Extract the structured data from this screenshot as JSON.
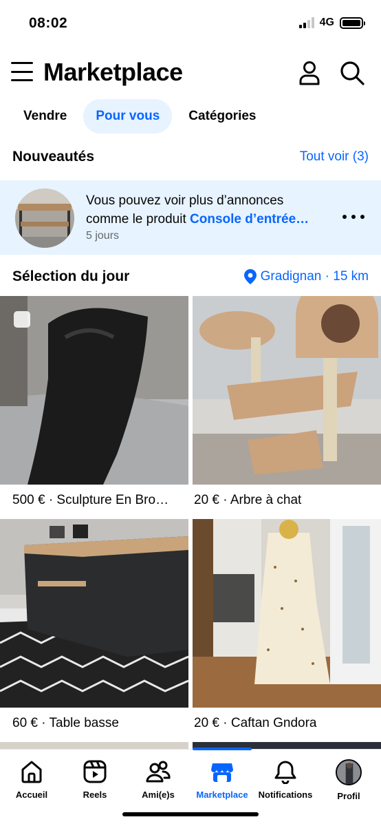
{
  "status": {
    "time": "08:02",
    "network": "4G"
  },
  "header": {
    "title": "Marketplace"
  },
  "tabs": [
    {
      "label": "Vendre",
      "active": false
    },
    {
      "label": "Pour vous",
      "active": true
    },
    {
      "label": "Catégories",
      "active": false
    }
  ],
  "news": {
    "title": "Nouveautés",
    "see_all": "Tout voir (3)",
    "card": {
      "text_line1": "Vous pouvez voir plus d’annonces",
      "text_line2_prefix": "comme le produit ",
      "text_line2_link": "Console d’entrée…",
      "time": "5 jours"
    }
  },
  "selection": {
    "title": "Sélection du jour",
    "location": "Gradignan · 15 km"
  },
  "items": [
    {
      "label": "500 € · Sculpture En Bro…"
    },
    {
      "label": "20 € · Arbre à chat"
    },
    {
      "label": "60 € · Table basse"
    },
    {
      "label": "20 € · Caftan Gndora"
    }
  ],
  "bottom_nav": [
    {
      "label": "Accueil",
      "icon": "home-icon"
    },
    {
      "label": "Reels",
      "icon": "reels-icon"
    },
    {
      "label": "Ami(e)s",
      "icon": "friends-icon"
    },
    {
      "label": "Marketplace",
      "icon": "marketplace-icon",
      "active": true
    },
    {
      "label": "Notifications",
      "icon": "bell-icon"
    },
    {
      "label": "Profil",
      "icon": "avatar"
    }
  ],
  "colors": {
    "accent": "#0866ff",
    "accent_bg": "#e7f3ff",
    "text": "#050505",
    "muted": "#65676b"
  }
}
